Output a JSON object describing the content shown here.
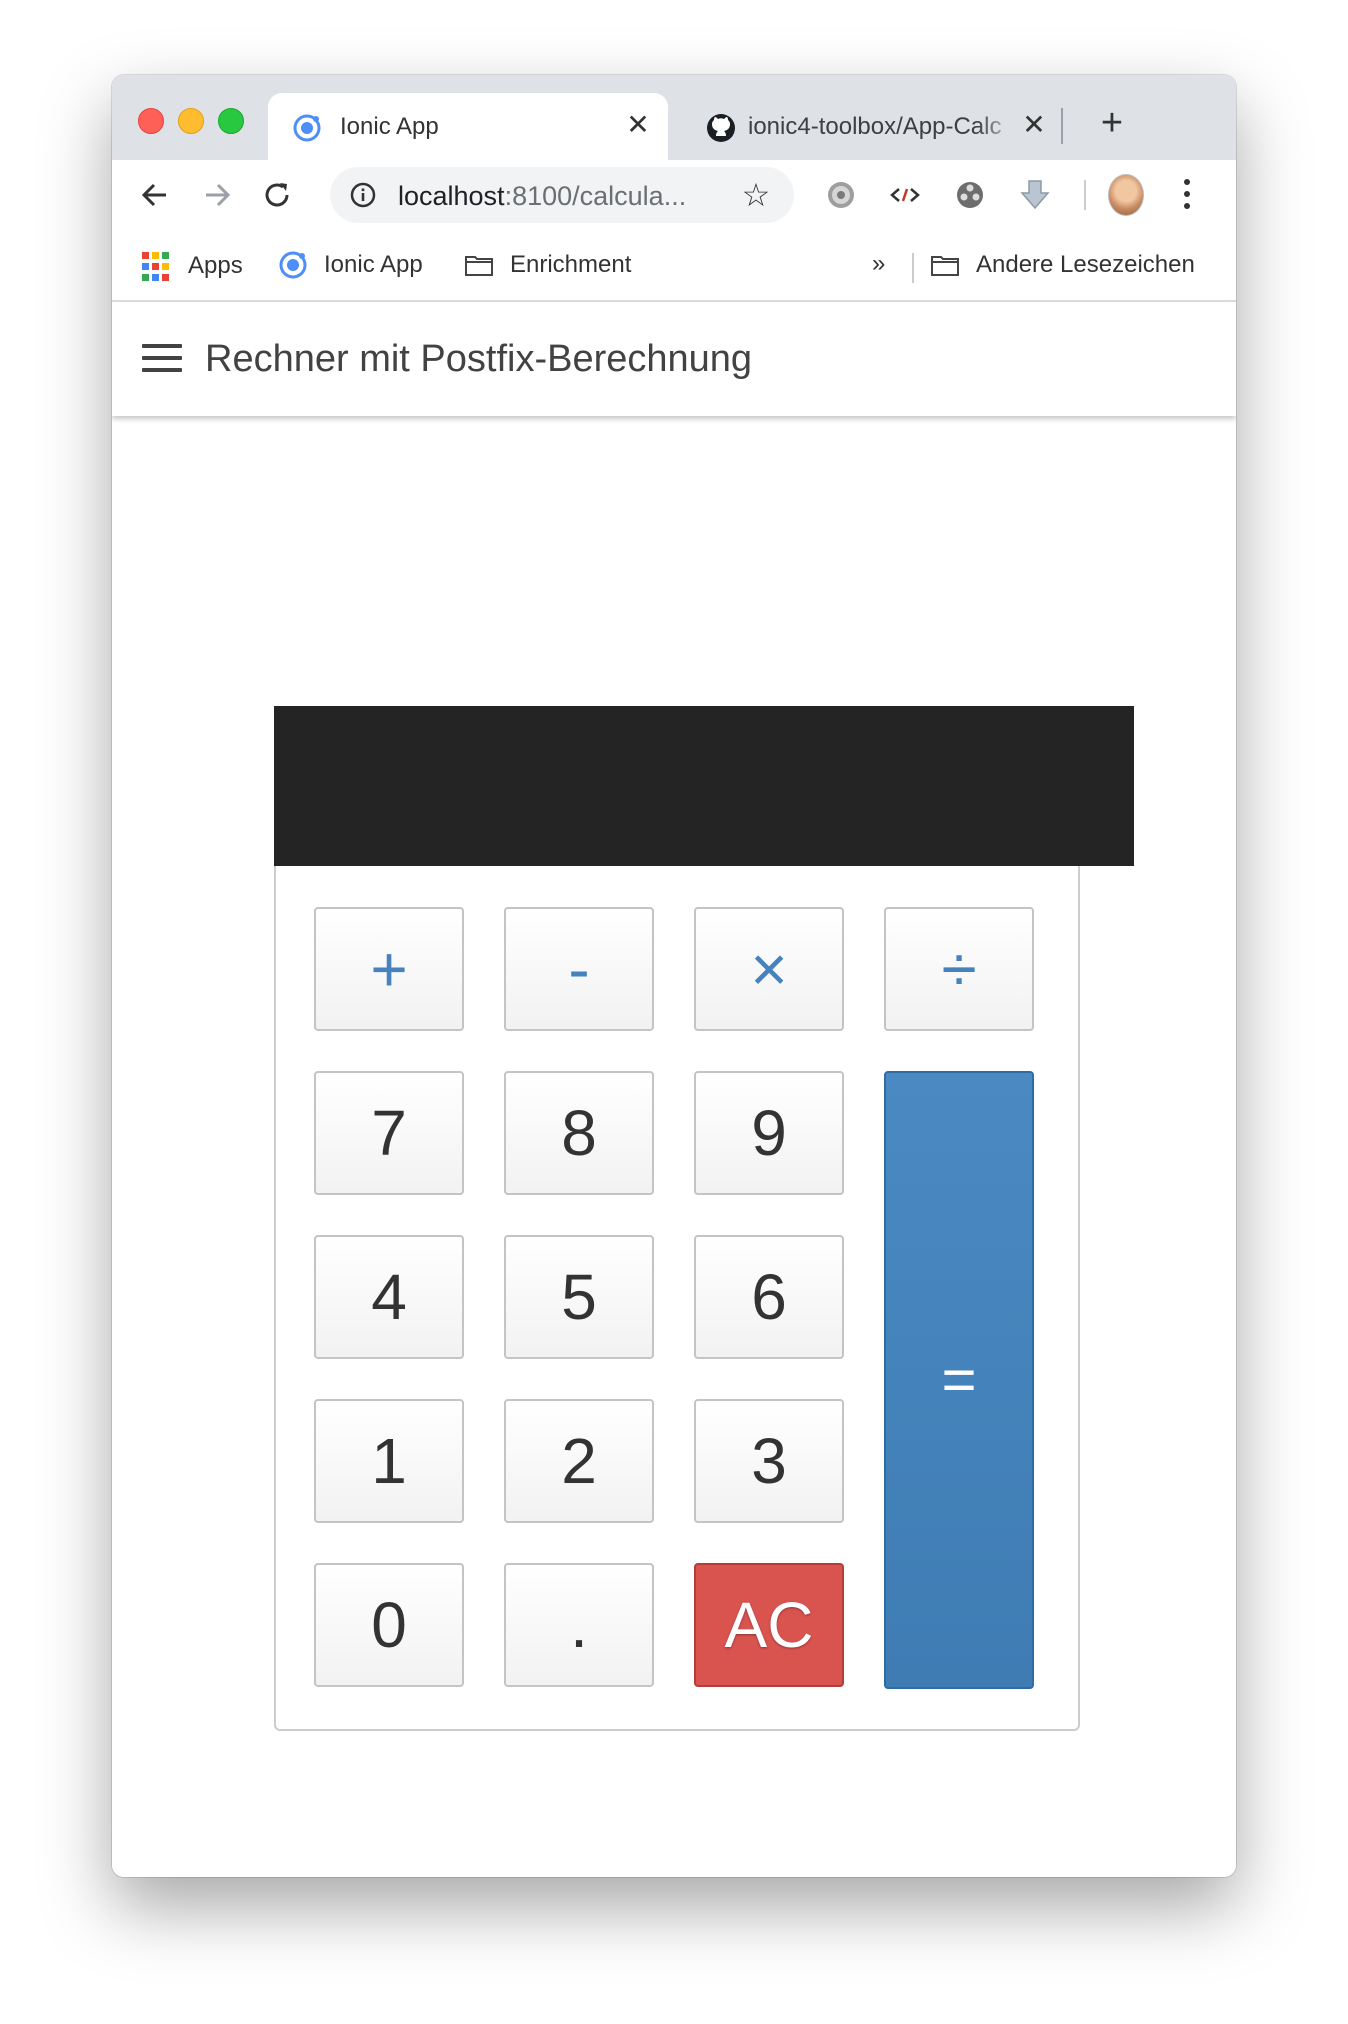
{
  "browser": {
    "tabs": [
      {
        "title": "Ionic App",
        "close": "✕"
      },
      {
        "title": "ionic4-toolbox/App-Calc",
        "close": "✕"
      }
    ],
    "new_tab": "+",
    "url_host": "localhost",
    "url_rest": ":8100/calcula...",
    "bookmarks": [
      {
        "label": "Apps"
      },
      {
        "label": "Ionic App"
      },
      {
        "label": "Enrichment"
      }
    ],
    "more_bookmarks": "»",
    "other_bookmarks": "Andere Lesezeichen"
  },
  "app": {
    "title": "Rechner mit Postfix-Berechnung",
    "display_value": ""
  },
  "keys": {
    "plus": "+",
    "minus": "-",
    "times": "×",
    "divide": "÷",
    "k7": "7",
    "k8": "8",
    "k9": "9",
    "k4": "4",
    "k5": "5",
    "k6": "6",
    "k1": "1",
    "k2": "2",
    "k3": "3",
    "k0": "0",
    "dot": ".",
    "ac": "AC",
    "equals": "="
  },
  "colors": {
    "operator_text": "#4582be",
    "equals_bg": "#4582be",
    "ac_bg": "#d9534f",
    "display_bg": "#242424"
  }
}
